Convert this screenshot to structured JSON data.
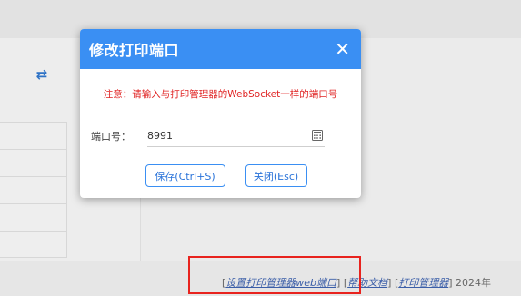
{
  "modal": {
    "title": "修改打印端口",
    "close_symbol": "✕",
    "notice": "注意：请输入与打印管理器的WebSocket一样的端口号",
    "port_label": "端口号：",
    "port_value": "8991",
    "save_label": "保存(Ctrl+S)",
    "close_label": "关闭(Esc)"
  },
  "background": {
    "refresh_icon": "⇄"
  },
  "footer": {
    "bracket_open": "[",
    "bracket_close": "]",
    "link_set_port": "设置打印管理器web端口",
    "link_help": "帮助文档",
    "link_manager": "打印管理器",
    "year_text": "2024年"
  },
  "colors": {
    "header_blue": "#3a8ff3",
    "notice_red": "#e02424",
    "highlight_red": "#e8231e"
  }
}
